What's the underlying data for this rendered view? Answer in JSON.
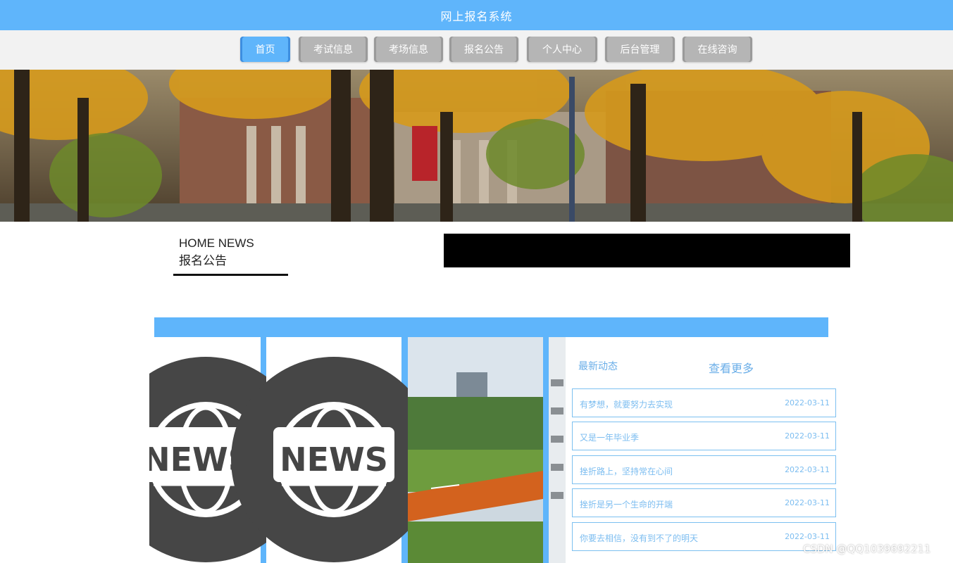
{
  "header": {
    "title": "网上报名系统"
  },
  "nav": {
    "items": [
      {
        "label": "首页",
        "active": true
      },
      {
        "label": "考试信息"
      },
      {
        "label": "考场信息"
      },
      {
        "label": "报名公告"
      },
      {
        "label": "个人中心"
      },
      {
        "label": "后台管理"
      },
      {
        "label": "在线咨询"
      }
    ]
  },
  "section": {
    "title_en": "HOME NEWS",
    "title_cn": "报名公告"
  },
  "gallery": {
    "news_text": "NEWS"
  },
  "news": {
    "heading": "最新动态",
    "more": "查看更多",
    "items": [
      {
        "title": "有梦想，就要努力去实现",
        "date": "2022-03-11"
      },
      {
        "title": "又是一年毕业季",
        "date": "2022-03-11"
      },
      {
        "title": "挫折路上，坚持常在心间",
        "date": "2022-03-11"
      },
      {
        "title": "挫折是另一个生命的开端",
        "date": "2022-03-11"
      },
      {
        "title": "你要去相信，没有到不了的明天",
        "date": "2022-03-11"
      }
    ]
  },
  "watermark": "CSDN @QQ1039692211",
  "colors": {
    "primary": "#5fb5fb",
    "nav_inactive": "#b5b5b5",
    "nav_bg": "#f2f2f2"
  }
}
